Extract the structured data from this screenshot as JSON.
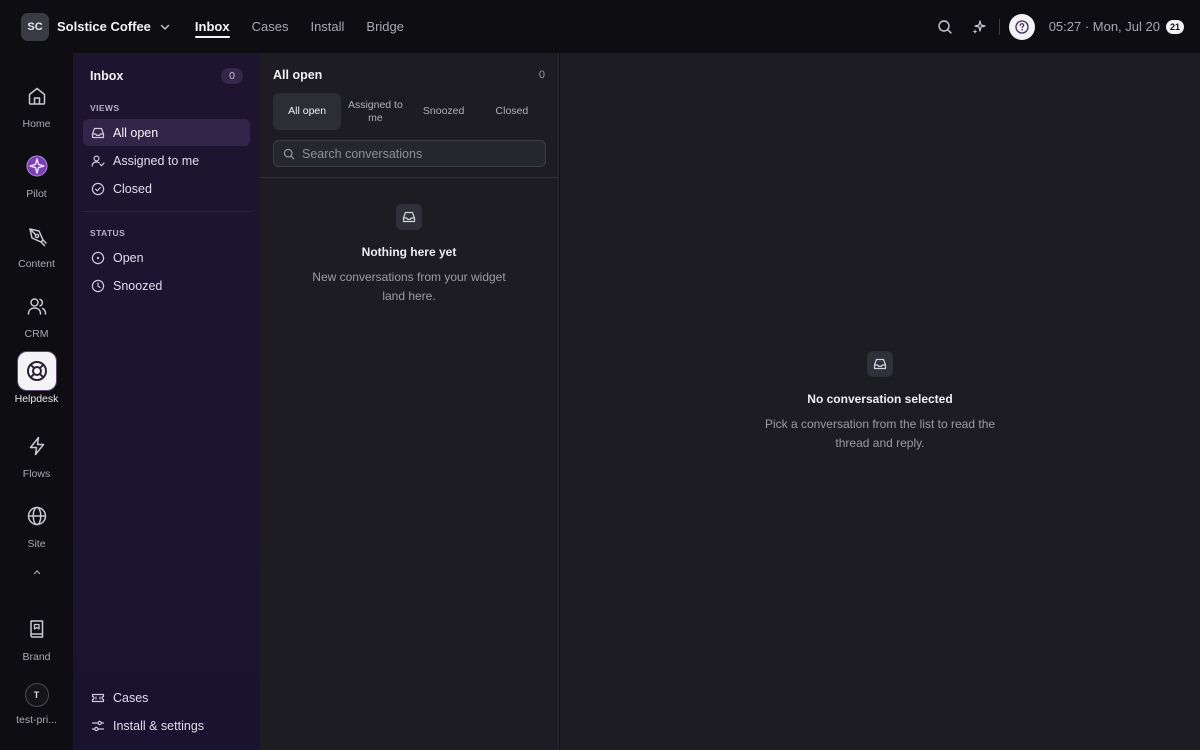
{
  "workspace": {
    "initials": "SC",
    "name": "Solstice Coffee"
  },
  "topnav": [
    {
      "label": "Inbox",
      "active": true
    },
    {
      "label": "Cases",
      "active": false
    },
    {
      "label": "Install",
      "active": false
    },
    {
      "label": "Bridge",
      "active": false
    }
  ],
  "clock": {
    "time": "05:27 · Mon, Jul 20",
    "badge": "21"
  },
  "rail": {
    "items": [
      {
        "label": "Home",
        "icon": "home-icon"
      },
      {
        "label": "Pilot",
        "icon": "pilot-icon"
      },
      {
        "label": "Content",
        "icon": "pen-icon"
      },
      {
        "label": "CRM",
        "icon": "users-icon"
      },
      {
        "label": "Helpdesk",
        "icon": "lifebuoy-icon",
        "active": true
      },
      {
        "label": "Flows",
        "icon": "lightning-icon"
      },
      {
        "label": "Site",
        "icon": "globe-icon"
      },
      {
        "label": "Brand",
        "icon": "book-icon"
      }
    ],
    "user": {
      "initial": "T",
      "label": "test-pri..."
    }
  },
  "inbox": {
    "title": "Inbox",
    "count": "0",
    "views_heading": "VIEWS",
    "views": [
      {
        "label": "All open",
        "icon": "inbox-icon",
        "active": true
      },
      {
        "label": "Assigned to me",
        "icon": "user-check-icon"
      },
      {
        "label": "Closed",
        "icon": "check-circle-icon"
      }
    ],
    "status_heading": "STATUS",
    "status": [
      {
        "label": "Open",
        "icon": "open-circle-icon"
      },
      {
        "label": "Snoozed",
        "icon": "clock-icon"
      }
    ],
    "footer": [
      {
        "label": "Cases",
        "icon": "ticket-icon"
      },
      {
        "label": "Install & settings",
        "icon": "sliders-icon"
      }
    ]
  },
  "list": {
    "title": "All open",
    "count": "0",
    "tabs": [
      {
        "label": "All open",
        "active": true
      },
      {
        "label": "Assigned to me"
      },
      {
        "label": "Snoozed"
      },
      {
        "label": "Closed"
      }
    ],
    "search_placeholder": "Search conversations",
    "empty_title": "Nothing here yet",
    "empty_desc": "New conversations from your widget land here."
  },
  "detail": {
    "empty_title": "No conversation selected",
    "empty_desc": "Pick a conversation from the list to read the thread and reply."
  }
}
